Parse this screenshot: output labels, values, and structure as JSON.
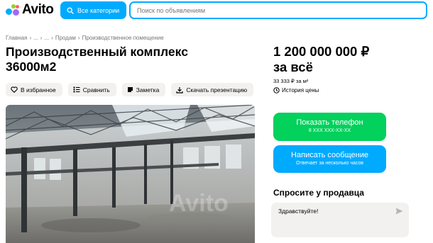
{
  "header": {
    "logo_text": "Avito",
    "categories_label": "Все категории",
    "search_placeholder": "Поиск по объявлениям"
  },
  "breadcrumbs": [
    "Главная",
    "...",
    "...",
    "Продам",
    "Производственное помещение"
  ],
  "breadcrumb_separator": "›",
  "listing": {
    "title_line1": "Производственный комплекс",
    "title_line2": "36000м2"
  },
  "actions": {
    "favorite_label": "В избранное",
    "compare_label": "Сравнить",
    "note_label": "Заметка",
    "download_label": "Скачать презентацию"
  },
  "price": {
    "amount": "1 200 000 000 ₽",
    "suffix": "за всё",
    "per_m2": "33 333 ₽ за м²",
    "history_label": "История цены"
  },
  "contact": {
    "phone_label": "Показать телефон",
    "phone_masked": "8 XXX XXX-XX-XX",
    "message_label": "Написать сообщение",
    "message_sub": "Отвечает за несколько часов"
  },
  "seller_question": {
    "heading": "Спросите у продавца",
    "input_value": "Здравствуйте!"
  },
  "colors": {
    "brand_blue": "#00aaff",
    "brand_green": "#02d15c",
    "chip_bg": "#f2f1f0"
  }
}
